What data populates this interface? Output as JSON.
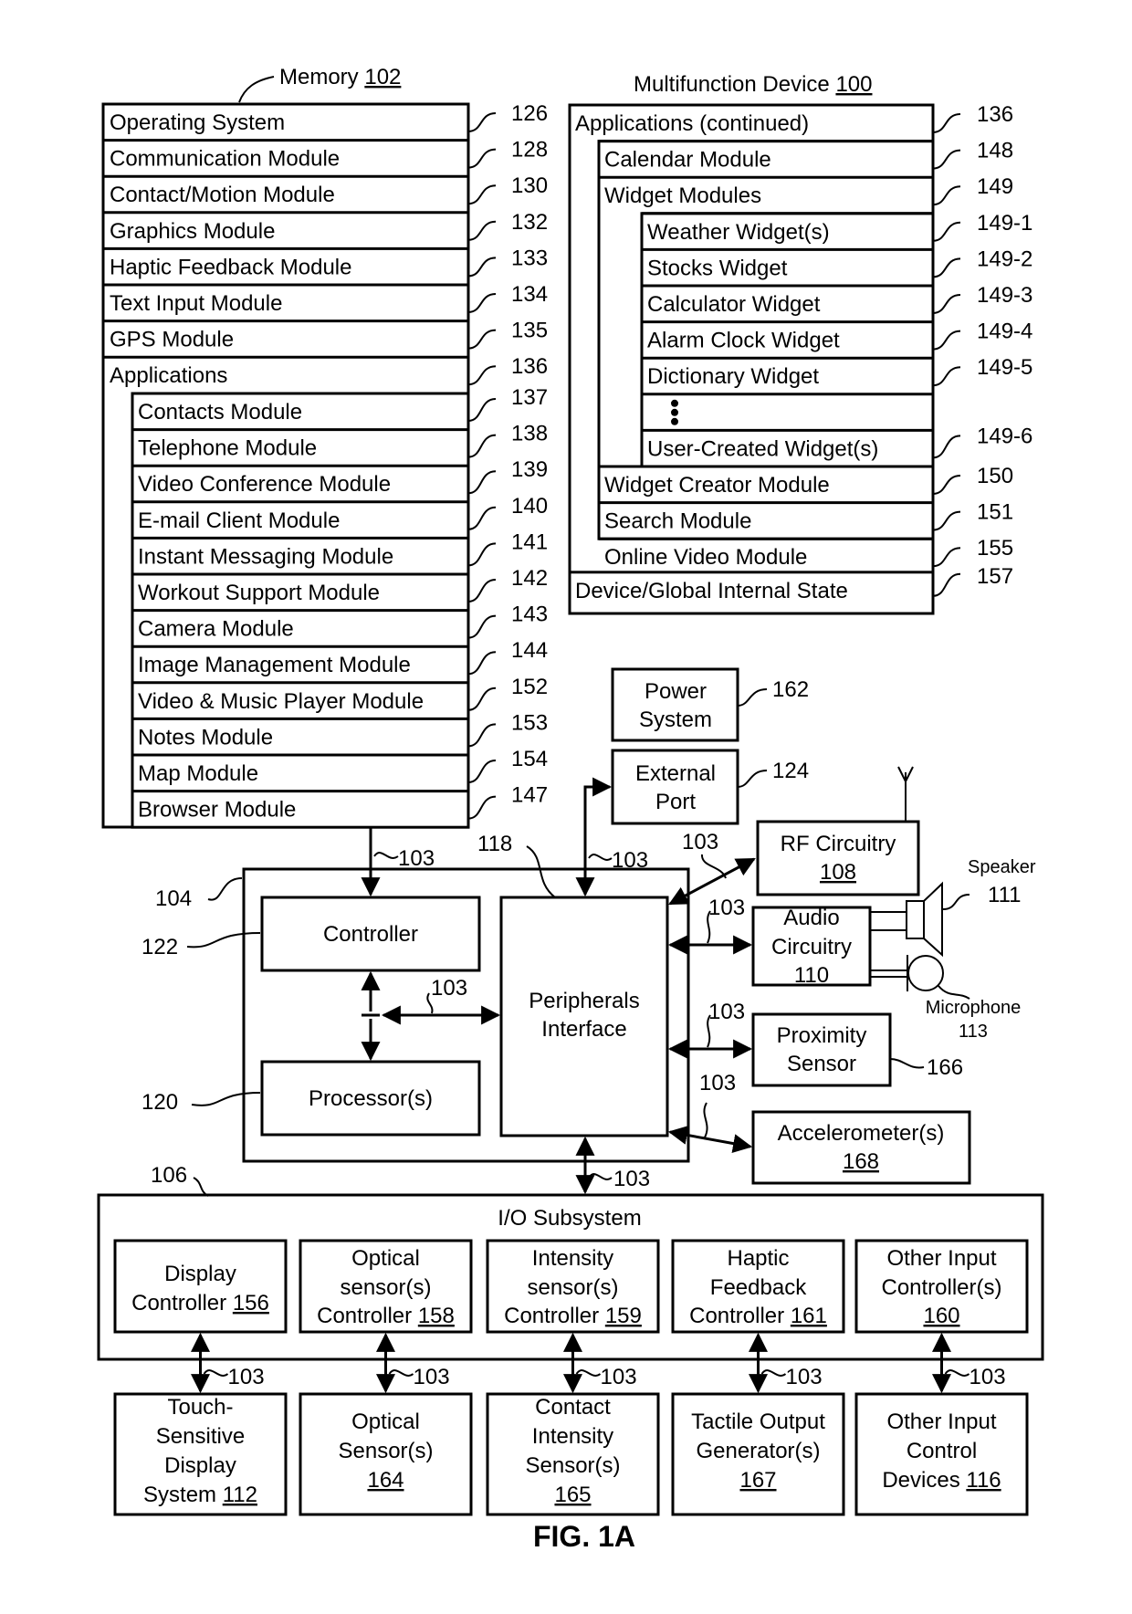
{
  "figure": {
    "caption": "FIG. 1A"
  },
  "memory": {
    "title": "Memory",
    "ref": "102",
    "rows": [
      {
        "label": "Operating System",
        "ref": "126"
      },
      {
        "label": "Communication Module",
        "ref": "128"
      },
      {
        "label": "Contact/Motion Module",
        "ref": "130"
      },
      {
        "label": "Graphics Module",
        "ref": "132"
      },
      {
        "label": "Haptic Feedback Module",
        "ref": "133"
      },
      {
        "label": "Text Input Module",
        "ref": "134"
      },
      {
        "label": "GPS Module",
        "ref": "135"
      },
      {
        "label": "Applications",
        "ref": "136"
      }
    ],
    "applications": [
      {
        "label": "Contacts Module",
        "ref": "137"
      },
      {
        "label": "Telephone Module",
        "ref": "138"
      },
      {
        "label": "Video Conference Module",
        "ref": "139"
      },
      {
        "label": "E-mail Client Module",
        "ref": "140"
      },
      {
        "label": "Instant Messaging Module",
        "ref": "141"
      },
      {
        "label": "Workout Support Module",
        "ref": "142"
      },
      {
        "label": "Camera Module",
        "ref": "143"
      },
      {
        "label": "Image Management Module",
        "ref": "144"
      },
      {
        "label": "Video & Music Player Module",
        "ref": "152"
      },
      {
        "label": "Notes Module",
        "ref": "153"
      },
      {
        "label": "Map Module",
        "ref": "154"
      },
      {
        "label": "Browser Module",
        "ref": "147"
      }
    ]
  },
  "device": {
    "title": "Multifunction Device",
    "ref": "100",
    "apps_continued": {
      "label": "Applications (continued)",
      "ref": "136"
    },
    "calendar": {
      "label": "Calendar Module",
      "ref": "148"
    },
    "widget_modules": {
      "label": "Widget Modules",
      "ref": "149"
    },
    "widgets": [
      {
        "label": "Weather Widget(s)",
        "ref": "149-1"
      },
      {
        "label": "Stocks Widget",
        "ref": "149-2"
      },
      {
        "label": "Calculator Widget",
        "ref": "149-3"
      },
      {
        "label": "Alarm Clock Widget",
        "ref": "149-4"
      },
      {
        "label": "Dictionary Widget",
        "ref": "149-5"
      },
      {
        "label": "User-Created Widget(s)",
        "ref": "149-6"
      }
    ],
    "other_modules": [
      {
        "label": "Widget Creator Module",
        "ref": "150"
      },
      {
        "label": "Search Module",
        "ref": "151"
      },
      {
        "label": "Online Video Module",
        "ref": "155"
      }
    ],
    "internal_state": {
      "label": "Device/Global Internal State",
      "ref": "157"
    }
  },
  "hardware": {
    "power": {
      "line1": "Power",
      "line2": "System",
      "ref": "162"
    },
    "external_port": {
      "line1": "External",
      "line2": "Port",
      "ref": "124"
    },
    "rf": {
      "line1": "RF Circuitry",
      "num": "108"
    },
    "audio": {
      "line1": "Audio",
      "line2": "Circuitry",
      "num": "110"
    },
    "speaker": {
      "label": "Speaker",
      "ref": "111"
    },
    "microphone": {
      "label": "Microphone",
      "ref": "113"
    },
    "proximity": {
      "line1": "Proximity",
      "line2": "Sensor",
      "ref": "166"
    },
    "accelerometer": {
      "line1": "Accelerometer(s)",
      "num": "168"
    },
    "controller": {
      "label": "Controller",
      "ref": "122"
    },
    "processor": {
      "label": "Processor(s)",
      "ref": "120"
    },
    "peripherals": {
      "line1": "Peripherals",
      "line2": "Interface",
      "ref": "118"
    },
    "chip_ref": "104",
    "bus_ref": "103"
  },
  "io": {
    "title": "I/O Subsystem",
    "ref": "106",
    "controllers": [
      {
        "lines": [
          "",
          "Display",
          "Controller "
        ],
        "num": "156"
      },
      {
        "lines": [
          "Optical",
          "sensor(s)",
          "Controller "
        ],
        "num": "158"
      },
      {
        "lines": [
          "Intensity",
          "sensor(s)",
          "Controller "
        ],
        "num": "159"
      },
      {
        "lines": [
          "Haptic",
          "Feedback",
          "Controller "
        ],
        "num": "161"
      },
      {
        "lines": [
          "Other Input",
          "Controller(s)",
          ""
        ],
        "num": "160"
      }
    ],
    "devices": [
      {
        "lines": [
          "Touch-",
          "Sensitive",
          "Display",
          "System "
        ],
        "num": "112"
      },
      {
        "lines": [
          "",
          "Optical",
          "Sensor(s)",
          ""
        ],
        "num": "164"
      },
      {
        "lines": [
          "Contact",
          "Intensity",
          "Sensor(s)",
          ""
        ],
        "num": "165"
      },
      {
        "lines": [
          "",
          "Tactile Output",
          "Generator(s)",
          ""
        ],
        "num": "167"
      },
      {
        "lines": [
          "",
          "Other Input",
          "Control",
          "Devices "
        ],
        "num": "116"
      }
    ]
  }
}
